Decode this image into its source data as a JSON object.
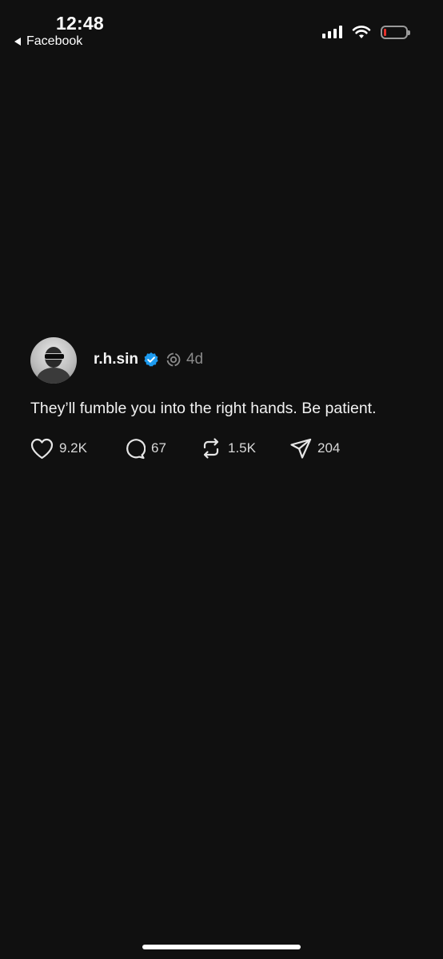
{
  "status_bar": {
    "time": "12:48",
    "back_label": "Facebook",
    "icons": [
      "cellular-signal-icon",
      "wifi-icon",
      "battery-icon"
    ],
    "battery_color": "#e5312b"
  },
  "post": {
    "username": "r.h.sin",
    "verified_color": "#1d9bf0",
    "time_ago": "4d",
    "text": "They’ll fumble you into the right hands. Be patient.",
    "actions": {
      "likes": "9.2K",
      "replies": "67",
      "reposts": "1.5K",
      "shares": "204"
    }
  },
  "colors": {
    "background": "#101010",
    "text": "#f2f2f2",
    "muted": "#8a8a8a"
  }
}
